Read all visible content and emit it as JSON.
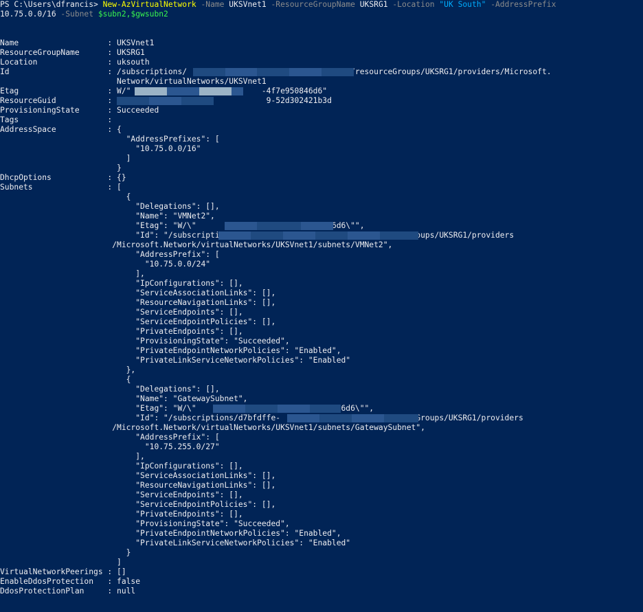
{
  "window": {
    "background": "#012456",
    "foreground": "#eeedf0"
  },
  "colors": {
    "command": "#ffff00",
    "parameter": "#8b8b8b",
    "string": "#00adff",
    "variable": "#39f44e",
    "redaction_dark": "#1f4a80",
    "redaction_light": "#9bb3c6"
  },
  "prompt": {
    "line1": [
      {
        "text": "PS C:\\Users\\dfrancis> ",
        "kind": "plain"
      },
      {
        "text": "New-AzVirtualNetwork",
        "kind": "cmd"
      },
      {
        "text": " -Name ",
        "kind": "param"
      },
      {
        "text": "UKSVnet1",
        "kind": "plain"
      },
      {
        "text": " -ResourceGroupName ",
        "kind": "param"
      },
      {
        "text": "UKSRG1",
        "kind": "plain"
      },
      {
        "text": " -Location ",
        "kind": "param"
      },
      {
        "text": "\"UK South\"",
        "kind": "str"
      },
      {
        "text": " -AddressPrefix",
        "kind": "param"
      }
    ],
    "line2": [
      {
        "text": "10.75.0.0/16",
        "kind": "plain"
      },
      {
        "text": " -Subnet ",
        "kind": "param"
      },
      {
        "text": "$subn2,$gwsubn2",
        "kind": "var"
      }
    ]
  },
  "output": [
    {
      "text": ""
    },
    {
      "text": ""
    },
    {
      "text": "Name                   : UKSVnet1"
    },
    {
      "text": "ResourceGroupName      : UKSRG1"
    },
    {
      "text": "Location               : uksouth"
    },
    {
      "text": "Id                     : /subscriptions/                                 4d/resourceGroups/UKSRG1/providers/Microsoft."
    },
    {
      "text": "                         Network/virtualNetworks/UKSVnet1"
    },
    {
      "text": "Etag                   : W/\"                            -4f7e950846d6\""
    },
    {
      "text": "ResourceGuid           :                                 9-52d302421b3d"
    },
    {
      "text": "ProvisioningState      : Succeeded"
    },
    {
      "text": "Tags                   :"
    },
    {
      "text": "AddressSpace           : {"
    },
    {
      "text": "                           \"AddressPrefixes\": ["
    },
    {
      "text": "                             \"10.75.0.0/16\""
    },
    {
      "text": "                           ]"
    },
    {
      "text": "                         }"
    },
    {
      "text": "DhcpOptions            : {}"
    },
    {
      "text": "Subnets                : ["
    },
    {
      "text": "                           {"
    },
    {
      "text": "                             \"Delegations\": [],"
    },
    {
      "text": "                             \"Name\": \"VMNet2\","
    },
    {
      "text": "                             \"Etag\": \"W/\\\"                          0846d6\\\"\","
    },
    {
      "text": "                             \"Id\": \"/subscriptions/d7bf                       /resourceGroups/UKSRG1/providers"
    },
    {
      "text": "                        /Microsoft.Network/virtualNetworks/UKSVnet1/subnets/VMNet2\","
    },
    {
      "text": "                             \"AddressPrefix\": ["
    },
    {
      "text": "                               \"10.75.0.0/24\""
    },
    {
      "text": "                             ],"
    },
    {
      "text": "                             \"IpConfigurations\": [],"
    },
    {
      "text": "                             \"ServiceAssociationLinks\": [],"
    },
    {
      "text": "                             \"ResourceNavigationLinks\": [],"
    },
    {
      "text": "                             \"ServiceEndpoints\": [],"
    },
    {
      "text": "                             \"ServiceEndpointPolicies\": [],"
    },
    {
      "text": "                             \"PrivateEndpoints\": [],"
    },
    {
      "text": "                             \"ProvisioningState\": \"Succeeded\","
    },
    {
      "text": "                             \"PrivateEndpointNetworkPolicies\": \"Enabled\","
    },
    {
      "text": "                             \"PrivateLinkServiceNetworkPolicies\": \"Enabled\""
    },
    {
      "text": "                           },"
    },
    {
      "text": "                           {"
    },
    {
      "text": "                             \"Delegations\": [],"
    },
    {
      "text": "                             \"Name\": \"GatewaySubnet\","
    },
    {
      "text": "                             \"Etag\": \"W/\\\"                           50846d6\\\"\","
    },
    {
      "text": "                             \"Id\": \"/subscriptions/d7bfdffe-                    /resourceGroups/UKSRG1/providers"
    },
    {
      "text": "                        /Microsoft.Network/virtualNetworks/UKSVnet1/subnets/GatewaySubnet\","
    },
    {
      "text": "                             \"AddressPrefix\": ["
    },
    {
      "text": "                               \"10.75.255.0/27\""
    },
    {
      "text": "                             ],"
    },
    {
      "text": "                             \"IpConfigurations\": [],"
    },
    {
      "text": "                             \"ServiceAssociationLinks\": [],"
    },
    {
      "text": "                             \"ResourceNavigationLinks\": [],"
    },
    {
      "text": "                             \"ServiceEndpoints\": [],"
    },
    {
      "text": "                             \"ServiceEndpointPolicies\": [],"
    },
    {
      "text": "                             \"PrivateEndpoints\": [],"
    },
    {
      "text": "                             \"ProvisioningState\": \"Succeeded\","
    },
    {
      "text": "                             \"PrivateEndpointNetworkPolicies\": \"Enabled\","
    },
    {
      "text": "                             \"PrivateLinkServiceNetworkPolicies\": \"Enabled\""
    },
    {
      "text": "                           }"
    },
    {
      "text": "                         ]"
    },
    {
      "text": "VirtualNetworkPeerings : []"
    },
    {
      "text": "EnableDdosProtection   : false"
    },
    {
      "text": "DdosProtectionPlan     : null"
    }
  ]
}
